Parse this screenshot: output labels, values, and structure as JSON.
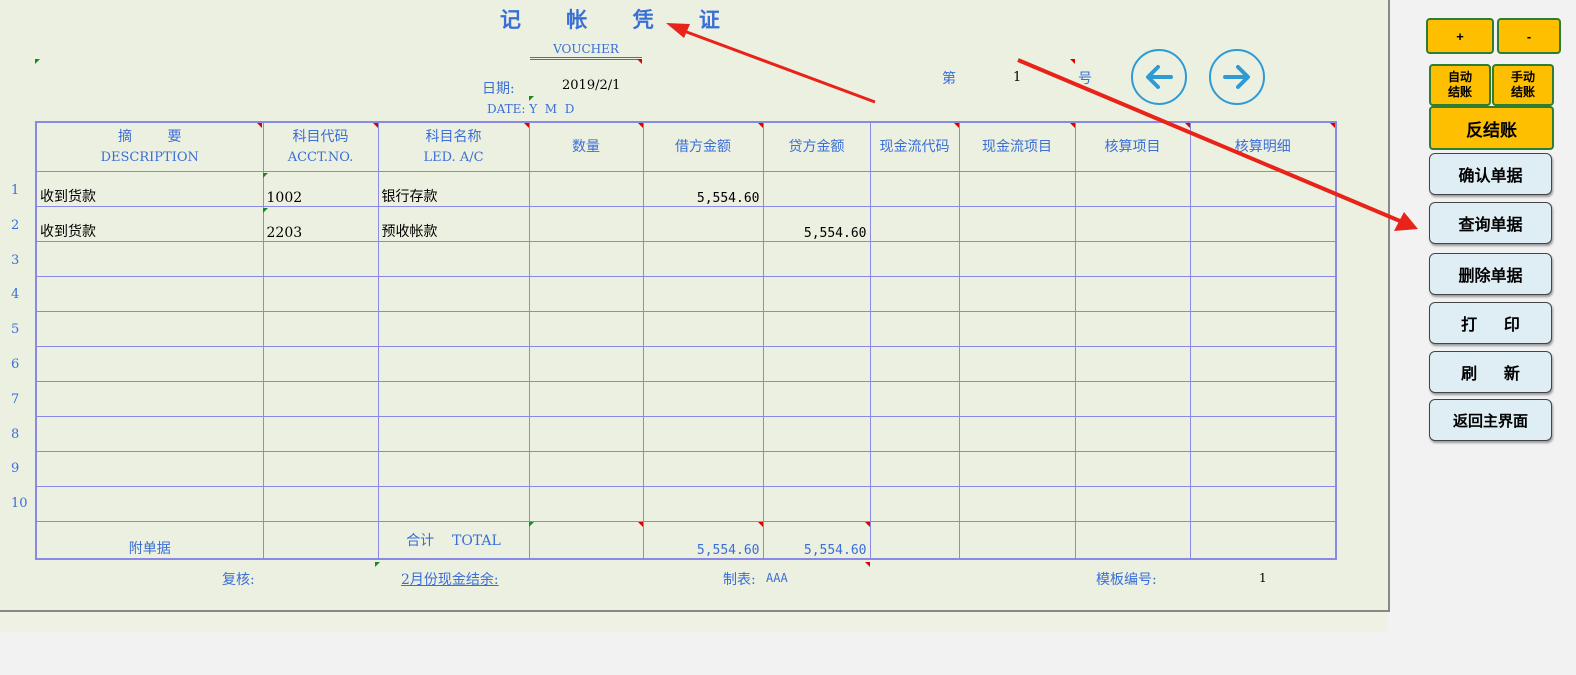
{
  "voucher": {
    "title": "记 帐 凭 证",
    "subtitle": "VOUCHER",
    "date_label": "日期:",
    "date_value": "2019/2/1",
    "date_sub": "DATE: Y  M  D",
    "no_prefix": "第",
    "no_value": "1",
    "no_suffix": "号"
  },
  "table": {
    "headers": [
      {
        "cn": "摘        要",
        "en": "DESCRIPTION"
      },
      {
        "cn": "科目代码",
        "en": "ACCT.NO."
      },
      {
        "cn": "科目名称",
        "en": "LED. A/C"
      },
      {
        "cn": "数量",
        "en": ""
      },
      {
        "cn": "借方金额",
        "en": ""
      },
      {
        "cn": "贷方金额",
        "en": ""
      },
      {
        "cn": "现金流代码",
        "en": ""
      },
      {
        "cn": "现金流项目",
        "en": ""
      },
      {
        "cn": "核算项目",
        "en": ""
      },
      {
        "cn": "核算明细",
        "en": ""
      }
    ],
    "row_numbers": [
      "1",
      "2",
      "3",
      "4",
      "5",
      "6",
      "7",
      "8",
      "9",
      "10"
    ],
    "rows": [
      {
        "desc": "收到货款",
        "acct": "1002",
        "name": "银行存款",
        "qty": "",
        "debit": "5,554.60",
        "credit": "",
        "cf_code": "",
        "cf_item": "",
        "acc_item": "",
        "acc_detail": ""
      },
      {
        "desc": "收到货款",
        "acct": "2203",
        "name": "预收帐款",
        "qty": "",
        "debit": "",
        "credit": "5,554.60",
        "cf_code": "",
        "cf_item": "",
        "acc_item": "",
        "acc_detail": ""
      },
      {
        "desc": "",
        "acct": "",
        "name": "",
        "qty": "",
        "debit": "",
        "credit": "",
        "cf_code": "",
        "cf_item": "",
        "acc_item": "",
        "acc_detail": ""
      },
      {
        "desc": "",
        "acct": "",
        "name": "",
        "qty": "",
        "debit": "",
        "credit": "",
        "cf_code": "",
        "cf_item": "",
        "acc_item": "",
        "acc_detail": ""
      },
      {
        "desc": "",
        "acct": "",
        "name": "",
        "qty": "",
        "debit": "",
        "credit": "",
        "cf_code": "",
        "cf_item": "",
        "acc_item": "",
        "acc_detail": ""
      },
      {
        "desc": "",
        "acct": "",
        "name": "",
        "qty": "",
        "debit": "",
        "credit": "",
        "cf_code": "",
        "cf_item": "",
        "acc_item": "",
        "acc_detail": ""
      },
      {
        "desc": "",
        "acct": "",
        "name": "",
        "qty": "",
        "debit": "",
        "credit": "",
        "cf_code": "",
        "cf_item": "",
        "acc_item": "",
        "acc_detail": ""
      },
      {
        "desc": "",
        "acct": "",
        "name": "",
        "qty": "",
        "debit": "",
        "credit": "",
        "cf_code": "",
        "cf_item": "",
        "acc_item": "",
        "acc_detail": ""
      },
      {
        "desc": "",
        "acct": "",
        "name": "",
        "qty": "",
        "debit": "",
        "credit": "",
        "cf_code": "",
        "cf_item": "",
        "acc_item": "",
        "acc_detail": ""
      },
      {
        "desc": "",
        "acct": "",
        "name": "",
        "qty": "",
        "debit": "",
        "credit": "",
        "cf_code": "",
        "cf_item": "",
        "acc_item": "",
        "acc_detail": ""
      }
    ],
    "total": {
      "attachment_label": "附单据",
      "total_label": "合计    TOTAL",
      "debit": "5,554.60",
      "credit": "5,554.60"
    }
  },
  "footer": {
    "review_label": "复核:",
    "cash_balance_link": "2月份现金结余:",
    "maker_label": "制表:",
    "maker_value": "AAA",
    "template_label": "模板编号:",
    "template_value": "1"
  },
  "buttons": {
    "plus": "+",
    "minus": "-",
    "auto_close": "自动\n结账",
    "manual_close": "手动\n结账",
    "reverse_close": "反结账",
    "confirm": "确认单据",
    "query": "查询单据",
    "delete": "删除单据",
    "print": "打      印",
    "refresh": "刷      新",
    "back_main": "返回主界面"
  },
  "icons": {
    "prev": "arrow-left-icon",
    "next": "arrow-right-icon"
  },
  "colors": {
    "accent_blue": "#3a6fd8",
    "grid_line": "#8a8ae6",
    "button_yellow": "#fdbf00",
    "button_green_border": "#2e7d32",
    "annotation_red": "#e8231a"
  }
}
